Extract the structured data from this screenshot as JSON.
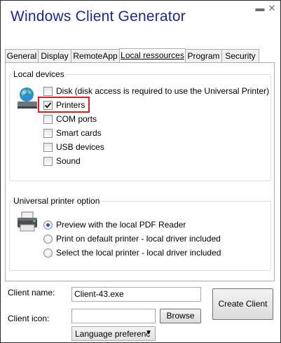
{
  "window": {
    "title": "Windows Client Generator",
    "minimize_glyph": "▬",
    "close_glyph": "✕"
  },
  "tabs": [
    {
      "label": "General"
    },
    {
      "label": "Display"
    },
    {
      "label": "RemoteApp"
    },
    {
      "label": "Local ressources",
      "active": true
    },
    {
      "label": "Program"
    },
    {
      "label": "Security"
    }
  ],
  "local_devices": {
    "legend": "Local devices",
    "icon": "globe-computer-icon",
    "items": [
      {
        "label": "Disk (disk access is required to use the Universal Printer)",
        "checked": false
      },
      {
        "label": "Printers",
        "checked": true
      },
      {
        "label": "COM ports",
        "checked": false
      },
      {
        "label": "Smart cards",
        "checked": false
      },
      {
        "label": "USB devices",
        "checked": false
      },
      {
        "label": "Sound",
        "checked": false
      }
    ]
  },
  "printer_option": {
    "legend": "Universal printer option",
    "icon": "printer-icon",
    "options": [
      {
        "label": "Preview with the local PDF Reader",
        "selected": true
      },
      {
        "label": "Print on default printer - local driver included",
        "selected": false
      },
      {
        "label": "Select the local printer - local driver included",
        "selected": false
      }
    ]
  },
  "bottom": {
    "client_name_label": "Client name:",
    "client_name_value": "Client-43.exe",
    "client_icon_label": "Client icon:",
    "client_icon_value": "",
    "browse_label": "Browse",
    "create_label": "Create Client",
    "language_value": "Language preferenc",
    "language_arrow": "▼"
  },
  "colors": {
    "title": "#1a2a8c",
    "highlight": "#d82020",
    "group_border": "#d5dfe5"
  }
}
